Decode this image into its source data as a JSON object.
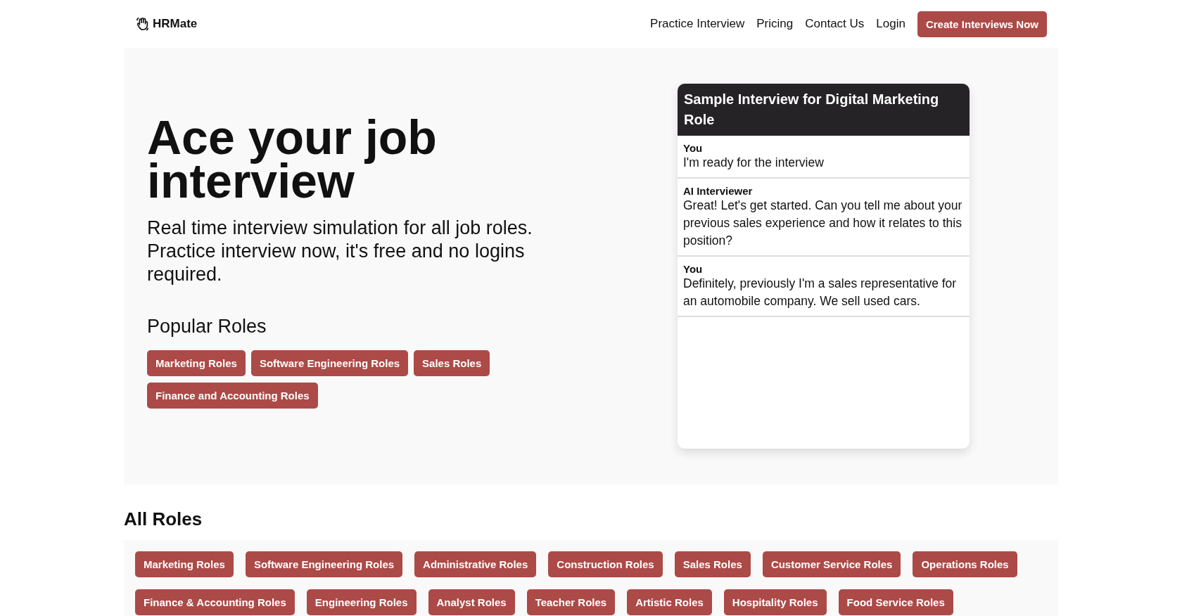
{
  "nav": {
    "brand": "HRMate",
    "links": [
      "Practice Interview",
      "Pricing",
      "Contact Us",
      "Login"
    ],
    "cta": "Create Interviews Now"
  },
  "hero": {
    "title": "Ace your job interview",
    "subtitle": "Real time interview simulation for all job roles. Practice interview now, it's free and no logins required.",
    "popular_heading": "Popular Roles",
    "popular_roles": [
      "Marketing Roles",
      "Software Engineering Roles",
      "Sales Roles",
      "Finance and Accounting Roles"
    ]
  },
  "sample": {
    "title": "Sample Interview for Digital Marketing Role",
    "messages": [
      {
        "speaker": "You",
        "text": "I'm ready for the interview"
      },
      {
        "speaker": "AI Interviewer",
        "text": "Great! Let's get started. Can you tell me about your previous sales experience and how it relates to this position?"
      },
      {
        "speaker": "You",
        "text": "Definitely, previously I'm a sales representative for an automobile company. We sell used cars."
      }
    ]
  },
  "all_roles": {
    "heading": "All Roles",
    "roles": [
      "Marketing Roles",
      "Software Engineering Roles",
      "Administrative Roles",
      "Construction Roles",
      "Sales Roles",
      "Customer Service Roles",
      "Operations Roles",
      "Finance & Accounting Roles",
      "Engineering Roles",
      "Analyst Roles",
      "Teacher Roles",
      "Artistic Roles",
      "Hospitality Roles",
      "Food Service Roles"
    ]
  }
}
